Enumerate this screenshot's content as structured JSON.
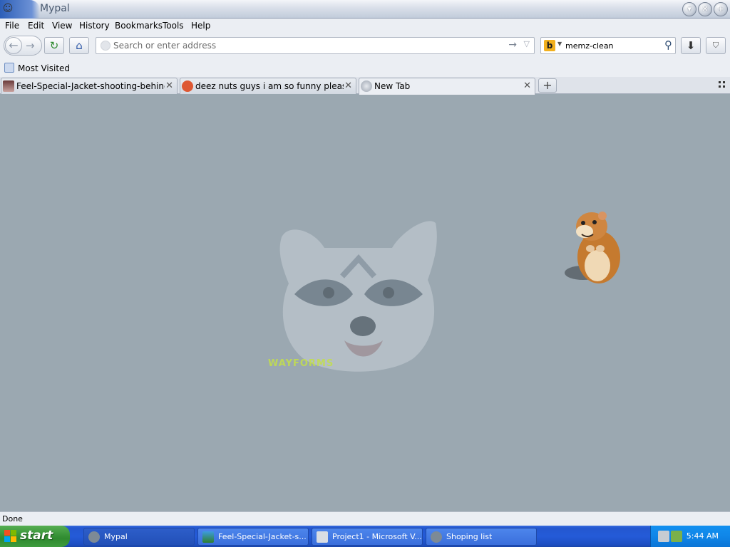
{
  "window": {
    "title": "Mypal"
  },
  "menu": [
    "File",
    "Edit",
    "View",
    "History",
    "Bookmarks",
    "Tools",
    "Help"
  ],
  "urlbar": {
    "value": "",
    "placeholder": "Search or enter address"
  },
  "searchbar": {
    "value": "memz-clean",
    "engine": "b"
  },
  "bookmarks": {
    "items": [
      "Most Visited"
    ]
  },
  "tabs": [
    {
      "label": "Feel-Special-Jacket-shooting-behind-twic...",
      "active": false
    },
    {
      "label": "deez nuts guys i am so funny please laug...",
      "active": false
    },
    {
      "label": "New Tab",
      "active": true
    }
  ],
  "content": {
    "raccoon_text": "WAYFORMS"
  },
  "statusbar": {
    "text": "Done"
  },
  "taskbar": {
    "start_label": "start",
    "tasks": [
      "Mypal",
      "Feel-Special-Jacket-s...",
      "Project1 - Microsoft V...",
      "Shoping list"
    ],
    "clock": "5:44 AM"
  },
  "colors": {
    "content_bg": "#9ba8b1",
    "taskbar": "#245bd8",
    "start_button": "#3b963b",
    "tray": "#0f86e8"
  }
}
